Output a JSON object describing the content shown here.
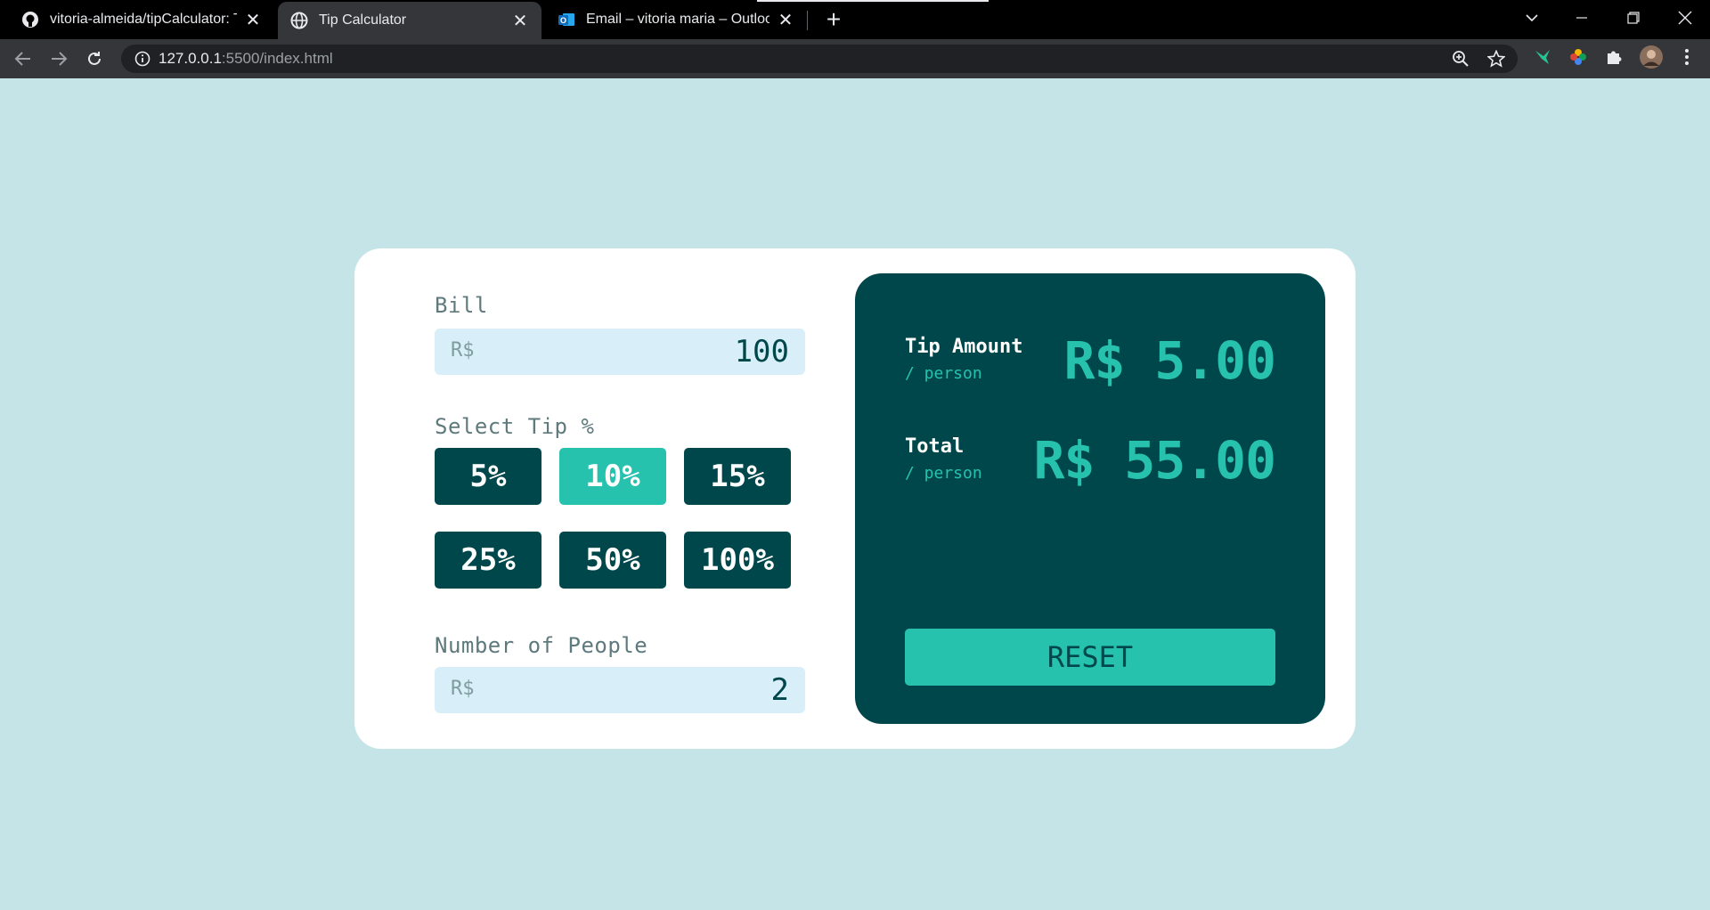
{
  "browser": {
    "tabs": [
      {
        "title": "vitoria-almeida/tipCalculator: Tip",
        "icon": "github-icon",
        "active": false
      },
      {
        "title": "Tip Calculator",
        "icon": "globe-icon",
        "active": true
      },
      {
        "title": "Email – vitoria maria – Outlook",
        "icon": "outlook-icon",
        "active": false
      }
    ],
    "new_tab": "+",
    "url_host": "127.0.0.1",
    "url_rest": ":5500/index.html"
  },
  "calculator": {
    "bill": {
      "label": "Bill",
      "prefix": "R$",
      "value": "100"
    },
    "tip": {
      "label": "Select Tip %",
      "options": [
        "5%",
        "10%",
        "15%",
        "25%",
        "50%",
        "100%"
      ],
      "selected": "10%"
    },
    "people": {
      "label": "Number of People",
      "prefix": "R$",
      "value": "2"
    },
    "results": {
      "tip_label": "Tip Amount",
      "tip_sub": "/ person",
      "tip_value": "R$ 5.00",
      "total_label": "Total",
      "total_sub": "/ person",
      "total_value": "R$ 55.00",
      "reset_label": "RESET"
    }
  },
  "colors": {
    "background": "#c5e4e7",
    "dark_teal": "#00474b",
    "accent": "#26c2ae",
    "input_bg": "#d8eef8"
  }
}
